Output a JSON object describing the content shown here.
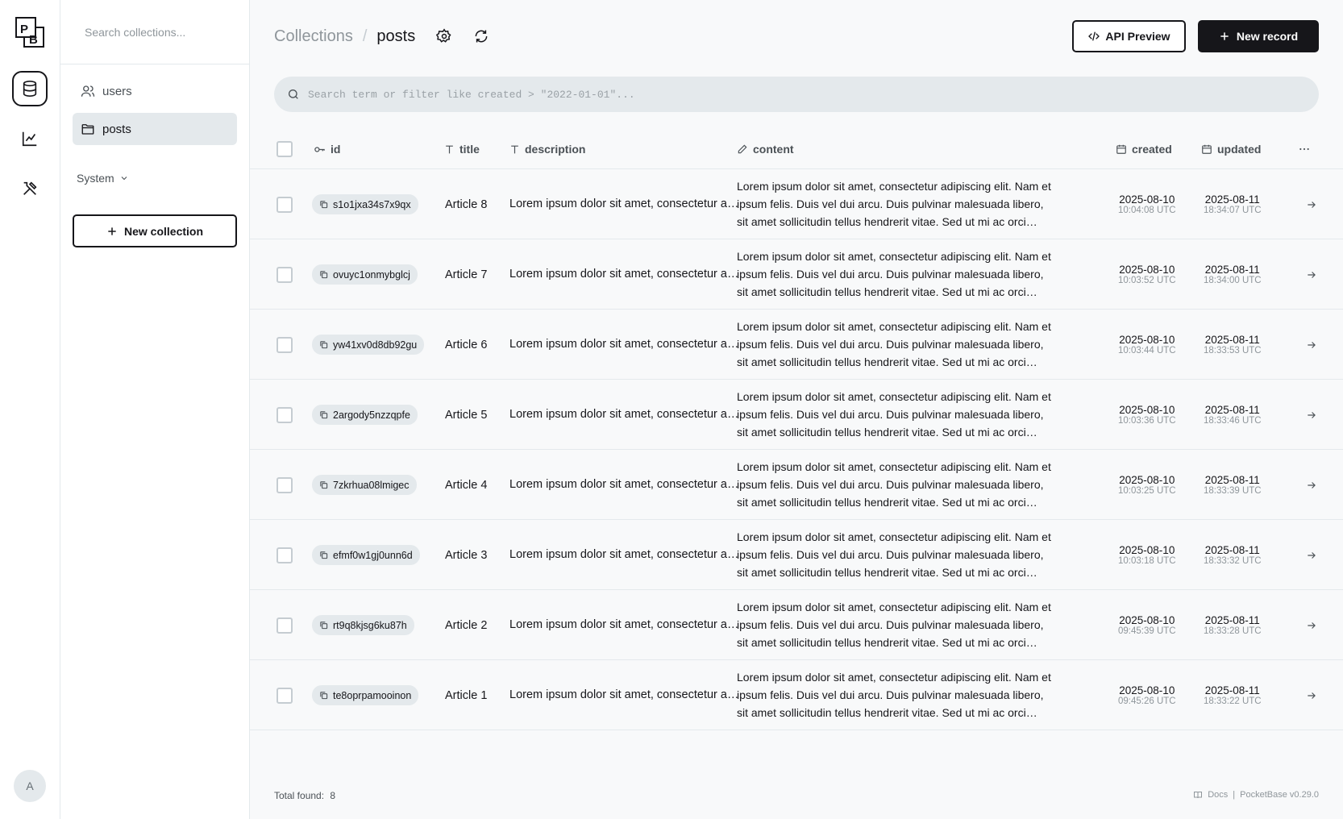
{
  "logo": {
    "letters": [
      "P",
      "B"
    ]
  },
  "rail": {
    "items": [
      {
        "name": "collections",
        "icon": "database-icon",
        "active": true
      },
      {
        "name": "logs",
        "icon": "chart-line-icon",
        "active": false
      },
      {
        "name": "settings",
        "icon": "tools-icon",
        "active": false
      }
    ],
    "avatar_letter": "A"
  },
  "sidebar": {
    "search_placeholder": "Search collections...",
    "collections": [
      {
        "label": "users",
        "icon": "users-icon",
        "active": false
      },
      {
        "label": "posts",
        "icon": "folder-icon",
        "active": true
      }
    ],
    "system_label": "System",
    "new_collection_label": "New collection"
  },
  "header": {
    "breadcrumb_root": "Collections",
    "breadcrumb_sep": "/",
    "breadcrumb_current": "posts",
    "api_preview_label": "API Preview",
    "new_record_label": "New record"
  },
  "search": {
    "placeholder": "Search term or filter like created > \"2022-01-01\"..."
  },
  "table": {
    "columns": [
      {
        "key": "id",
        "label": "id",
        "icon": "key-icon"
      },
      {
        "key": "title",
        "label": "title",
        "icon": "text-icon"
      },
      {
        "key": "description",
        "label": "description",
        "icon": "text-icon"
      },
      {
        "key": "content",
        "label": "content",
        "icon": "pencil-icon"
      },
      {
        "key": "created",
        "label": "created",
        "icon": "calendar-icon"
      },
      {
        "key": "updated",
        "label": "updated",
        "icon": "calendar-icon"
      }
    ],
    "rows": [
      {
        "id": "s1o1jxa34s7x9qx",
        "title": "Article 8",
        "description": "Lorem ipsum dolor sit amet, consectetur adipiscing elit.",
        "content": "Lorem ipsum dolor sit amet, consectetur adipiscing elit. Nam et ipsum felis. Duis vel dui arcu. Duis pulvinar malesuada libero, sit amet sollicitudin tellus hendrerit vitae. Sed ut mi ac orci molestie.",
        "created_date": "2025-08-10",
        "created_time": "10:04:08 UTC",
        "updated_date": "2025-08-11",
        "updated_time": "18:34:07 UTC"
      },
      {
        "id": "ovuyc1onmybglcj",
        "title": "Article 7",
        "description": "Lorem ipsum dolor sit amet, consectetur adipiscing elit.",
        "content": "Lorem ipsum dolor sit amet, consectetur adipiscing elit. Nam et ipsum felis. Duis vel dui arcu. Duis pulvinar malesuada libero, sit amet sollicitudin tellus hendrerit vitae. Sed ut mi ac orci molestie.",
        "created_date": "2025-08-10",
        "created_time": "10:03:52 UTC",
        "updated_date": "2025-08-11",
        "updated_time": "18:34:00 UTC"
      },
      {
        "id": "yw41xv0d8db92gu",
        "title": "Article 6",
        "description": "Lorem ipsum dolor sit amet, consectetur adipiscing elit.",
        "content": "Lorem ipsum dolor sit amet, consectetur adipiscing elit. Nam et ipsum felis. Duis vel dui arcu. Duis pulvinar malesuada libero, sit amet sollicitudin tellus hendrerit vitae. Sed ut mi ac orci molestie.",
        "created_date": "2025-08-10",
        "created_time": "10:03:44 UTC",
        "updated_date": "2025-08-11",
        "updated_time": "18:33:53 UTC"
      },
      {
        "id": "2argody5nzzqpfe",
        "title": "Article 5",
        "description": "Lorem ipsum dolor sit amet, consectetur adipiscing elit.",
        "content": "Lorem ipsum dolor sit amet, consectetur adipiscing elit. Nam et ipsum felis. Duis vel dui arcu. Duis pulvinar malesuada libero, sit amet sollicitudin tellus hendrerit vitae. Sed ut mi ac orci molestie.",
        "created_date": "2025-08-10",
        "created_time": "10:03:36 UTC",
        "updated_date": "2025-08-11",
        "updated_time": "18:33:46 UTC"
      },
      {
        "id": "7zkrhua08lmigec",
        "title": "Article 4",
        "description": "Lorem ipsum dolor sit amet, consectetur adipiscing elit.",
        "content": "Lorem ipsum dolor sit amet, consectetur adipiscing elit. Nam et ipsum felis. Duis vel dui arcu. Duis pulvinar malesuada libero, sit amet sollicitudin tellus hendrerit vitae. Sed ut mi ac orci molestie.",
        "created_date": "2025-08-10",
        "created_time": "10:03:25 UTC",
        "updated_date": "2025-08-11",
        "updated_time": "18:33:39 UTC"
      },
      {
        "id": "efmf0w1gj0unn6d",
        "title": "Article 3",
        "description": "Lorem ipsum dolor sit amet, consectetur adipiscing elit.",
        "content": "Lorem ipsum dolor sit amet, consectetur adipiscing elit. Nam et ipsum felis. Duis vel dui arcu. Duis pulvinar malesuada libero, sit amet sollicitudin tellus hendrerit vitae. Sed ut mi ac orci molestie.",
        "created_date": "2025-08-10",
        "created_time": "10:03:18 UTC",
        "updated_date": "2025-08-11",
        "updated_time": "18:33:32 UTC"
      },
      {
        "id": "rt9q8kjsg6ku87h",
        "title": "Article 2",
        "description": "Lorem ipsum dolor sit amet, consectetur adipiscing elit.",
        "content": "Lorem ipsum dolor sit amet, consectetur adipiscing elit. Nam et ipsum felis. Duis vel dui arcu. Duis pulvinar malesuada libero, sit amet sollicitudin tellus hendrerit vitae. Sed ut mi ac orci molestie.",
        "created_date": "2025-08-10",
        "created_time": "09:45:39 UTC",
        "updated_date": "2025-08-11",
        "updated_time": "18:33:28 UTC"
      },
      {
        "id": "te8oprpamooinon",
        "title": "Article 1",
        "description": "Lorem ipsum dolor sit amet, consectetur adipiscing elit.",
        "content": "Lorem ipsum dolor sit amet, consectetur adipiscing elit. Nam et ipsum felis. Duis vel dui arcu. Duis pulvinar malesuada libero, sit amet sollicitudin tellus hendrerit vitae. Sed ut mi ac orci molestie.",
        "created_date": "2025-08-10",
        "created_time": "09:45:26 UTC",
        "updated_date": "2025-08-11",
        "updated_time": "18:33:22 UTC"
      }
    ]
  },
  "footer": {
    "total_label": "Total found:",
    "total_count": "8",
    "docs_label": "Docs",
    "separator": "|",
    "version_label": "PocketBase v0.29.0"
  },
  "colors": {
    "primary": "#16161a",
    "background": "#f8f9fa",
    "surface": "#ffffff",
    "muted": "#e4e9ec",
    "hint": "#8f969b"
  }
}
